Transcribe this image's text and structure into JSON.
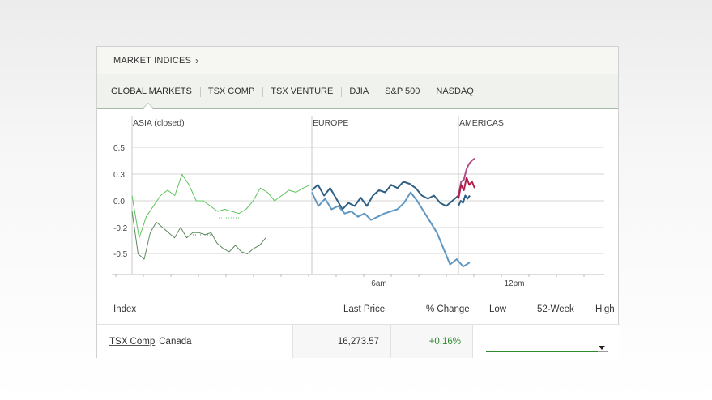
{
  "header": {
    "title": "MARKET INDICES",
    "chevron": "›"
  },
  "tabs": [
    {
      "label": "GLOBAL MARKETS",
      "active": true
    },
    {
      "label": "TSX COMP",
      "active": false
    },
    {
      "label": "TSX VENTURE",
      "active": false
    },
    {
      "label": "DJIA",
      "active": false
    },
    {
      "label": "S&P 500",
      "active": false
    },
    {
      "label": "NASDAQ",
      "active": false
    }
  ],
  "chart_data": {
    "type": "line",
    "regions": [
      "ASIA (closed)",
      "EUROPE",
      "AMERICAS"
    ],
    "y_ticks": [
      "0.5",
      "0.3",
      "0.0",
      "-0.2",
      "-0.5"
    ],
    "x_ticks": [
      "6am",
      "12pm"
    ],
    "colors": {
      "asia_light": "#5cc45c",
      "asia_dark": "#5e8a5e",
      "europe_dark": "#2f5f82",
      "europe_light": "#5f97c2",
      "americas_pink": "#b0508a",
      "americas_red": "#b01e4a",
      "americas_dark": "#2f5f82"
    },
    "series": [
      {
        "color_key": "asia_light",
        "values": [
          0.05,
          -0.35,
          -0.15,
          -0.05,
          0.05,
          0.1,
          0.05,
          0.25,
          0.15,
          0.0,
          0.0,
          -0.05,
          -0.1,
          -0.08,
          -0.1,
          -0.12,
          -0.08,
          0.0,
          0.12,
          0.08,
          0.0,
          0.05,
          0.1,
          0.08,
          0.12,
          0.15
        ]
      },
      {
        "color_key": "asia_dark",
        "values": [
          -0.1,
          -0.5,
          -0.55,
          -0.3,
          -0.2,
          -0.25,
          -0.3,
          -0.35,
          -0.25,
          -0.35,
          -0.3,
          -0.3,
          -0.32,
          -0.3,
          -0.4,
          -0.45,
          -0.48,
          -0.42,
          -0.48,
          -0.5,
          -0.45,
          -0.42,
          -0.35
        ]
      },
      {
        "color_key": "europe_dark",
        "values": [
          0.1,
          0.15,
          0.05,
          0.12,
          0.02,
          -0.08,
          -0.02,
          -0.05,
          0.03,
          -0.05,
          0.05,
          0.1,
          0.08,
          0.15,
          0.12,
          0.18,
          0.16,
          0.12,
          0.05,
          0.02,
          0.05,
          -0.02,
          -0.05,
          0.0,
          0.05
        ]
      },
      {
        "color_key": "europe_light",
        "values": [
          0.08,
          -0.05,
          0.02,
          -0.08,
          -0.05,
          -0.12,
          -0.1,
          -0.15,
          -0.12,
          -0.18,
          -0.15,
          -0.12,
          -0.1,
          -0.08,
          -0.02,
          0.08,
          0.0,
          -0.1,
          -0.2,
          -0.3,
          -0.45,
          -0.6,
          -0.55,
          -0.62,
          -0.58
        ]
      },
      {
        "color_key": "americas_pink",
        "values": [
          0.05,
          0.18,
          0.2,
          0.3,
          0.35,
          0.38,
          0.4
        ]
      },
      {
        "color_key": "americas_red",
        "values": [
          0.02,
          0.15,
          0.1,
          0.22,
          0.15,
          0.18,
          0.12
        ]
      },
      {
        "color_key": "americas_dark",
        "values": [
          -0.05,
          0.0,
          -0.02,
          0.05,
          0.02,
          0.05
        ]
      }
    ]
  },
  "table": {
    "headers": {
      "index": "Index",
      "last_price": "Last Price",
      "change": "% Change",
      "low": "Low",
      "week": "52-Week",
      "high": "High"
    },
    "rows": [
      {
        "name": "TSX Comp",
        "country": "Canada",
        "last_price": "16,273.57",
        "change": "+0.16%",
        "range_fill_fraction": 0.92,
        "range_marker_fraction": 0.9
      }
    ]
  }
}
